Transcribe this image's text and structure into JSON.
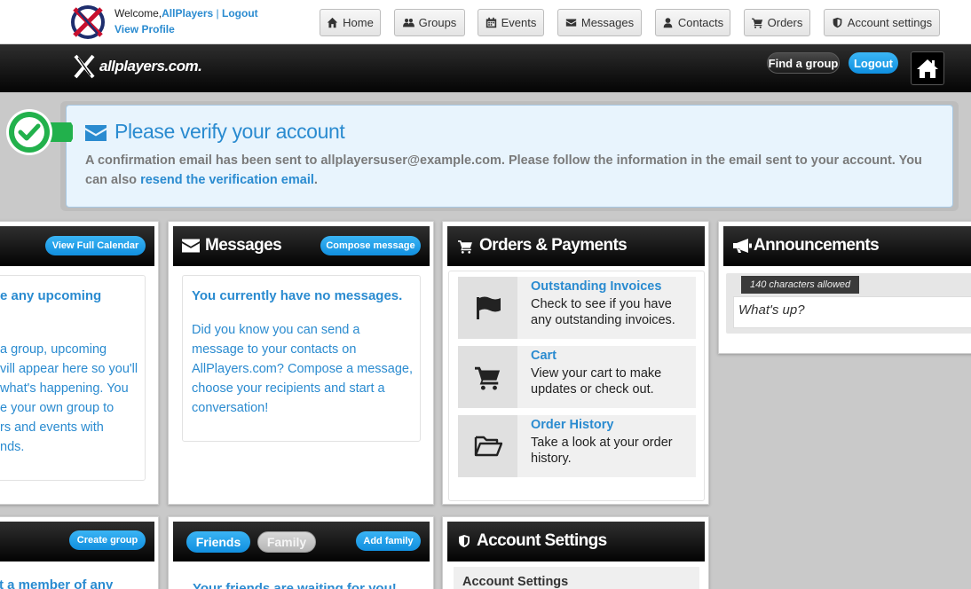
{
  "header": {
    "welcome_prefix": "Welcome,",
    "username": "AllPlayers",
    "separator": "|",
    "logout": "Logout",
    "view_profile": "View Profile",
    "nav": [
      {
        "label": "Home",
        "icon": "home-icon"
      },
      {
        "label": "Groups",
        "icon": "groups-icon"
      },
      {
        "label": "Events",
        "icon": "calendar-icon"
      },
      {
        "label": "Messages",
        "icon": "envelope-icon"
      },
      {
        "label": "Contacts",
        "icon": "user-icon"
      },
      {
        "label": "Orders",
        "icon": "cart-icon"
      },
      {
        "label": "Account settings",
        "icon": "shield-icon"
      }
    ]
  },
  "banner": {
    "brand": "allplayers.com.",
    "find_group": "Find a group",
    "logout": "Logout"
  },
  "alert": {
    "title": "Please verify your account",
    "body_text": "A confirmation email has been sent to allplayersuser@example.com. Please follow the information in the email sent to your account. You can also ",
    "link": "resend the verification email",
    "tail": "."
  },
  "calendar": {
    "button": "View Full Calendar",
    "heading": "e any upcoming",
    "body_lines": [
      "a group, upcoming",
      "vill appear here so you'll",
      "what's happening. You"
    ],
    "link": "e your own group",
    "link_tail": " to",
    "tail_lines": [
      "rs and events with",
      "nds."
    ]
  },
  "messages": {
    "title": "Messages",
    "button": "Compose message",
    "heading": "You currently have no messages.",
    "body": "Did you know you can send a message to your contacts on AllPlayers.com? Compose a message, choose your recipients and start a conversation!"
  },
  "orders": {
    "title": "Orders & Payments",
    "rows": [
      {
        "title": "Outstanding Invoices",
        "desc": "Check to see if you have any outstanding invoices.",
        "icon": "flag-icon"
      },
      {
        "title": "Cart",
        "desc": "View your cart to make updates or check out.",
        "icon": "cart-icon"
      },
      {
        "title": "Order History",
        "desc": "Take a look at your order history.",
        "icon": "folder-open-icon"
      }
    ]
  },
  "announcements": {
    "title": "Announcements",
    "limit": "140 characters allowed",
    "placeholder": "What's up?"
  },
  "groups": {
    "button": "Create group",
    "heading": "t a member of any"
  },
  "friends": {
    "tab_friends": "Friends",
    "tab_family": "Family",
    "button": "Add family",
    "heading": "Your friends are waiting for you!"
  },
  "account": {
    "title": "Account Settings",
    "subheading": "Account Settings"
  },
  "colors": {
    "link_blue": "#2a8bd0",
    "button_blue": "#1b9be8",
    "alert_bg": "#e8f4fd",
    "check_green": "#22b14c"
  }
}
